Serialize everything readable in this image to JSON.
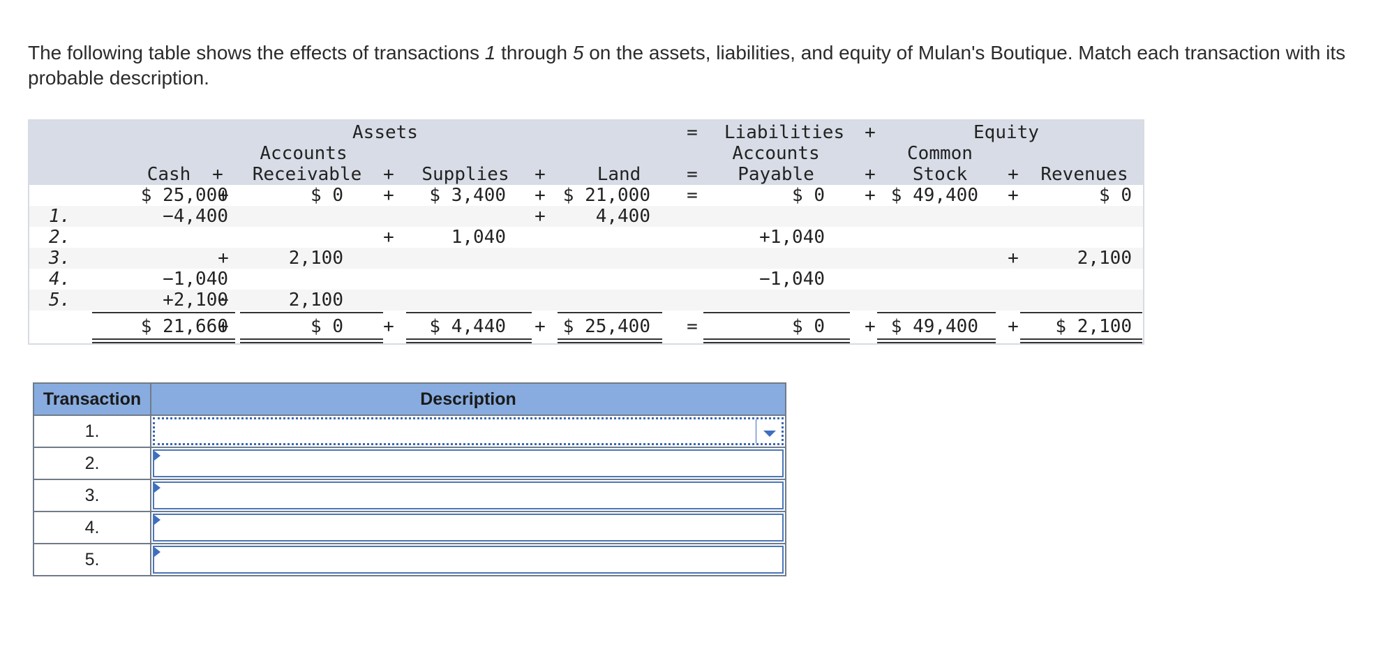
{
  "prompt": {
    "part1": "The following table shows the effects of transactions ",
    "num1": "1",
    "part2": " through ",
    "num2": "5",
    "part3": " on the assets, liabilities, and equity of Mulan's Boutique. Match each transaction with its probable description."
  },
  "equation": {
    "group_assets": "Assets",
    "group_liabilities": "Liabilities",
    "group_equity": "Equity",
    "header_plus": "+",
    "header_eq": "=",
    "headers": {
      "cash": "Cash",
      "ar_top": "Accounts",
      "ar_bottom": "Receivable",
      "supplies": "Supplies",
      "land": "Land",
      "ap_top": "Accounts",
      "ap_bottom": "Payable",
      "cs_top": "Common",
      "cs_bottom": "Stock",
      "revenues": "Revenues"
    },
    "beginning": {
      "cash": "$ 25,000",
      "ar": "$ 0",
      "supplies": "$ 3,400",
      "land": "$ 21,000",
      "ap": "$ 0",
      "cs": "$ 49,400",
      "revenues": "$ 0"
    },
    "rows": [
      {
        "label": "1.",
        "cash": "−4,400",
        "land_op": "+",
        "land": "4,400"
      },
      {
        "label": "2.",
        "supplies_op": "+",
        "supplies": "1,040",
        "ap": "+1,040"
      },
      {
        "label": "3.",
        "ar_op": "+",
        "ar": "2,100",
        "rev_op": "+",
        "revenues": "2,100"
      },
      {
        "label": "4.",
        "cash": "−1,040",
        "ap": "−1,040"
      },
      {
        "label": "5.",
        "cash": "+2,100",
        "ar_op": "−",
        "ar": "2,100"
      }
    ],
    "ending": {
      "cash": "$ 21,660",
      "ar": "$ 0",
      "supplies": "$ 4,440",
      "land": "$ 25,400",
      "ap": "$ 0",
      "cs": "$ 49,400",
      "revenues": "$ 2,100"
    }
  },
  "matching": {
    "col_transaction": "Transaction",
    "col_description": "Description",
    "rows": [
      {
        "num": "1.",
        "value": ""
      },
      {
        "num": "2.",
        "value": ""
      },
      {
        "num": "3.",
        "value": ""
      },
      {
        "num": "4.",
        "value": ""
      },
      {
        "num": "5.",
        "value": ""
      }
    ]
  }
}
